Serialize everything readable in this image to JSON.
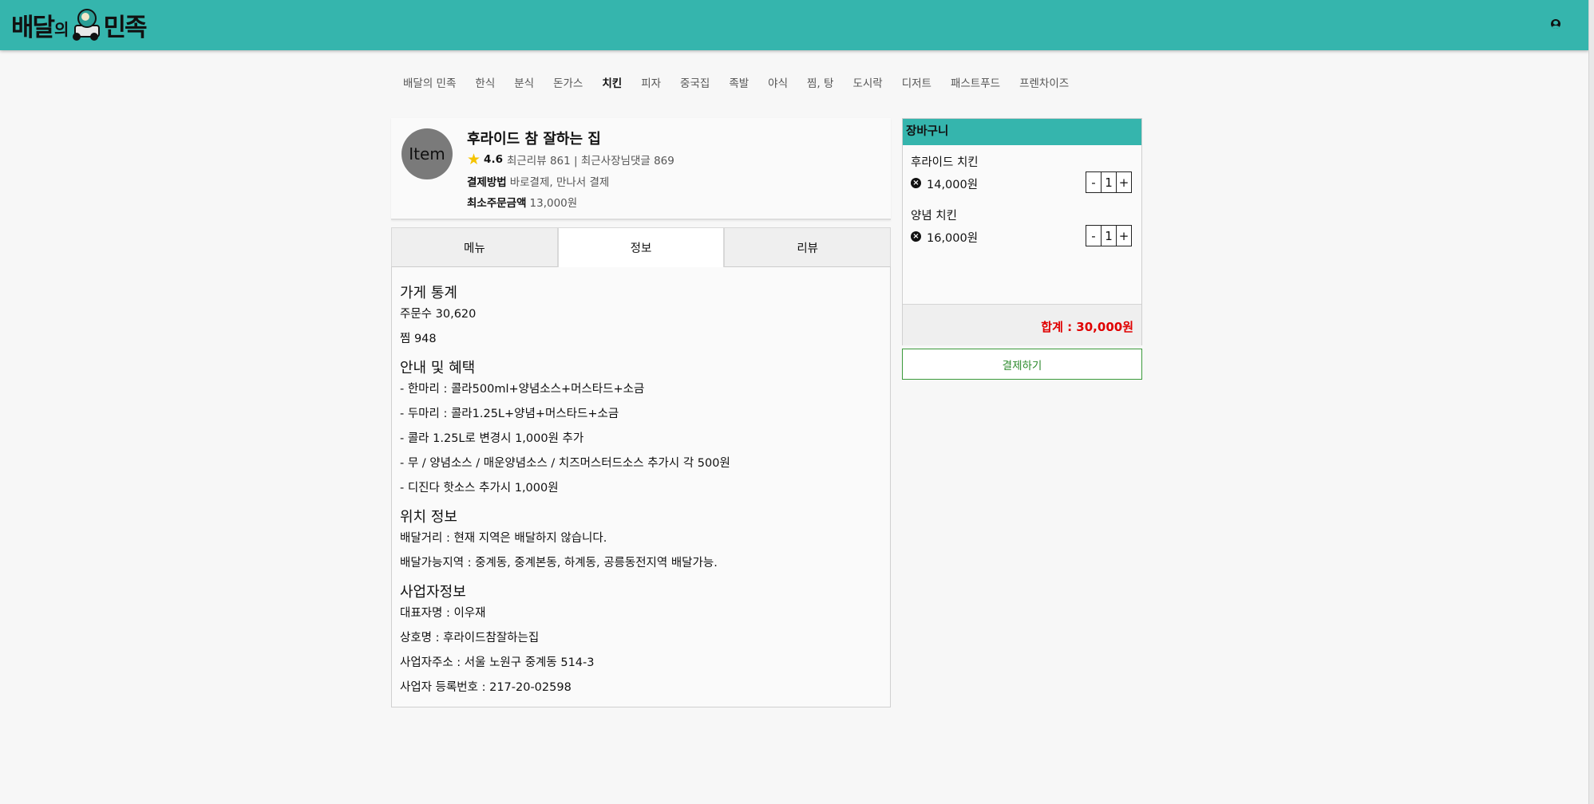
{
  "header": {
    "logo_part1": "배달",
    "logo_part2": "의",
    "logo_part3": "민족"
  },
  "nav": [
    "배달의 민족",
    "한식",
    "분식",
    "돈가스",
    "치킨",
    "피자",
    "중국집",
    "족발",
    "야식",
    "찜, 탕",
    "도시락",
    "디저트",
    "패스트푸드",
    "프렌차이즈"
  ],
  "nav_active": "치킨",
  "store": {
    "avatar_text": "Item",
    "name": "후라이드 참 잘하는 집",
    "rating": "4.6",
    "review_text": "최근리뷰 861 | 최근사장님댓글 869",
    "pay_label": "결제방법",
    "pay_value": "바로결제, 만나서 결제",
    "min_label": "최소주문금액",
    "min_value": "13,000원"
  },
  "tabs": [
    "메뉴",
    "정보",
    "리뷰"
  ],
  "active_tab": "정보",
  "info": {
    "stats_title": "가게 통계",
    "stats": [
      "주문수 30,620",
      "찜 948"
    ],
    "benefit_title": "안내 및 혜택",
    "benefits": [
      "- 한마리 : 콜라500ml+양념소스+머스타드+소금",
      "- 두마리 : 콜라1.25L+양념+머스타드+소금",
      "- 콜라 1.25L로 변경시 1,000원 추가",
      "- 무 / 양념소스 / 매운양념소스 / 치즈머스터드소스 추가시 각 500원",
      "- 디진다 핫소스 추가시 1,000원"
    ],
    "location_title": "위치 정보",
    "location": [
      "배달거리 : 현재 지역은 배달하지 않습니다.",
      "배달가능지역 : 중계동, 중계본동, 하계동, 공릉동전지역 배달가능."
    ],
    "biz_title": "사업자정보",
    "biz": [
      "대표자명 : 이우재",
      "상호명 : 후라이드참잘하는집",
      "사업자주소 : 서울 노원구 중계동 514-3",
      "사업자 등록번호 : 217-20-02598"
    ]
  },
  "cart": {
    "title": "장바구니",
    "items": [
      {
        "name": "후라이드 치킨",
        "price": "14,000원",
        "qty": "1"
      },
      {
        "name": "양념 치킨",
        "price": "16,000원",
        "qty": "1"
      }
    ],
    "total": "합계 : 30,000원",
    "pay_button": "결제하기"
  },
  "colors": {
    "brand": "#35b5ad",
    "total_red": "#e00000",
    "pay_green": "#2c8a2c"
  }
}
